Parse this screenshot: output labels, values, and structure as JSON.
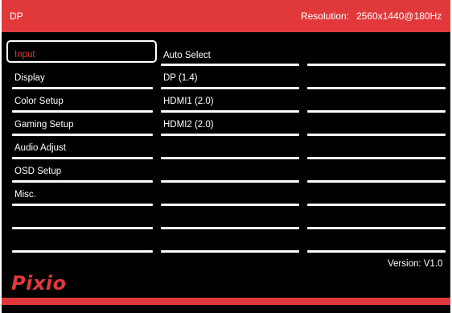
{
  "header": {
    "source": "DP",
    "resolution_label": "Resolution:",
    "resolution_value": "2560x1440@180Hz"
  },
  "menu": [
    {
      "label": "Input",
      "selected": true
    },
    {
      "label": "Display"
    },
    {
      "label": "Color Setup"
    },
    {
      "label": "Gaming Setup"
    },
    {
      "label": "Audio Adjust"
    },
    {
      "label": "OSD Setup"
    },
    {
      "label": "Misc."
    }
  ],
  "submenu": [
    {
      "label": "Auto Select"
    },
    {
      "label": "DP (1.4)"
    },
    {
      "label": "HDMI1 (2.0)"
    },
    {
      "label": "HDMI2 (2.0)"
    }
  ],
  "footer": {
    "version": "Version: V1.0",
    "logo": "Pixio"
  },
  "colors": {
    "accent": "#e1393b",
    "background": "#000000",
    "text": "#ffffff"
  }
}
